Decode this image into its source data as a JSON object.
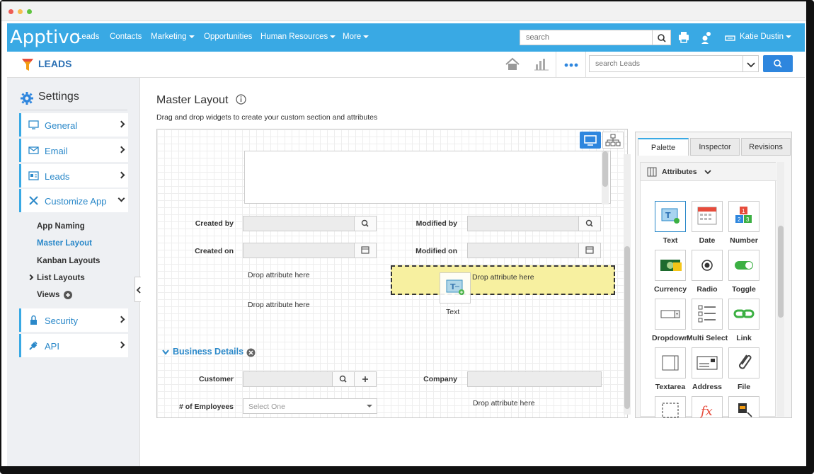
{
  "nav": {
    "logo": "Apptivo",
    "links": [
      "Leads",
      "Contacts",
      "Marketing",
      "Opportunities",
      "Human Resources",
      "More"
    ],
    "search_placeholder": "search",
    "user": "Katie Dustin"
  },
  "app": {
    "title": "LEADS",
    "search_placeholder": "search Leads"
  },
  "sidebar": {
    "heading": "Settings",
    "items": [
      {
        "label": "General",
        "icon": "monitor-icon"
      },
      {
        "label": "Email",
        "icon": "envelope-icon"
      },
      {
        "label": "Leads",
        "icon": "leads-card-icon"
      },
      {
        "label": "Customize App",
        "icon": "wrench-icon"
      }
    ],
    "subitems": [
      "App Naming",
      "Master Layout",
      "Kanban Layouts",
      "List Layouts",
      "Views"
    ],
    "items2": [
      {
        "label": "Security",
        "icon": "lock-icon"
      },
      {
        "label": "API",
        "icon": "plug-icon"
      }
    ]
  },
  "main": {
    "title": "Master Layout",
    "description": "Drag and drop widgets to create your custom section and attributes",
    "fields": {
      "created_by": "Created by",
      "modified_by": "Modified by",
      "created_on": "Created on",
      "modified_on": "Modified on",
      "customer": "Customer",
      "company": "Company",
      "employees": "# of Employees",
      "employees_value": "Select One"
    },
    "drop_text": "Drop attribute here",
    "drag_widget_label": "Text",
    "section": "Business Details"
  },
  "panel": {
    "tabs": [
      "Palette",
      "Inspector",
      "Revisions"
    ],
    "attributes_header": "Attributes",
    "widgets": [
      "Text",
      "Date",
      "Number",
      "Currency",
      "Radio",
      "Toggle",
      "Dropdown",
      "Multi Select",
      "Link",
      "Textarea",
      "Address",
      "File"
    ]
  },
  "colors": {
    "brand": "#39a9e4",
    "link": "#2a88c9",
    "highlight_drop": "#f7f0a0"
  }
}
